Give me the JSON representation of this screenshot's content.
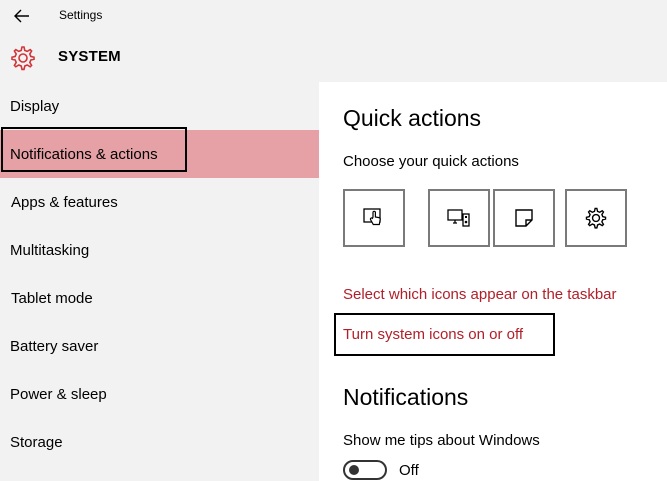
{
  "titlebar": {
    "back_icon": "back-arrow-icon",
    "app_title": "Settings"
  },
  "header": {
    "icon": "gear-icon",
    "title": "SYSTEM",
    "accent_color": "#d13438"
  },
  "sidebar": {
    "items": [
      {
        "label": "Display"
      },
      {
        "label": "Notifications & actions",
        "selected": true
      },
      {
        "label": "Apps & features"
      },
      {
        "label": "Multitasking"
      },
      {
        "label": "Tablet mode"
      },
      {
        "label": "Battery saver"
      },
      {
        "label": "Power & sleep"
      },
      {
        "label": "Storage"
      }
    ],
    "selected_color": "#e5a1a5"
  },
  "main": {
    "quick_actions_title": "Quick actions",
    "quick_actions_subtitle": "Choose your quick actions",
    "quick_action_tiles": [
      {
        "icon": "tablet-mode-icon"
      },
      {
        "icon": "connect-display-icon"
      },
      {
        "icon": "note-icon"
      },
      {
        "icon": "settings-gear-icon"
      }
    ],
    "links": {
      "select_icons": "Select which icons appear on the taskbar",
      "system_icons": "Turn system icons on or off"
    },
    "link_color": "#b0202a",
    "notifications_title": "Notifications",
    "tips_label": "Show me tips about Windows",
    "tips_toggle_state": "Off"
  }
}
